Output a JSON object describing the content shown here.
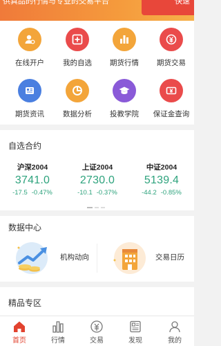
{
  "banner": {
    "text": "供真品的行情与专业的交易平台",
    "right_text": "快速"
  },
  "grid": [
    {
      "label": "在线开户",
      "icon": "user-plus-icon",
      "color": "#f3a53a"
    },
    {
      "label": "我的自选",
      "icon": "plus-square-icon",
      "color": "#ea4b4b"
    },
    {
      "label": "期货行情",
      "icon": "bar-chart-icon",
      "color": "#f3a53a"
    },
    {
      "label": "期货交易",
      "icon": "yuan-coin-icon",
      "color": "#ea4b4b"
    },
    {
      "label": "期货资讯",
      "icon": "news-card-icon",
      "color": "#4a7fe0"
    },
    {
      "label": "数据分析",
      "icon": "pie-chart-icon",
      "color": "#f3a53a"
    },
    {
      "label": "投教学院",
      "icon": "graduation-cap-icon",
      "color": "#8a5ad8"
    },
    {
      "label": "保证金查询",
      "icon": "yuan-ticket-icon",
      "color": "#ea4b4b"
    }
  ],
  "watchlist": {
    "title": "自选合约",
    "quotes": [
      {
        "name": "沪深2004",
        "price": "3741.0",
        "change": "-17.5",
        "pct": "-0.47%"
      },
      {
        "name": "上证2004",
        "price": "2730.0",
        "change": "-10.1",
        "pct": "-0.37%"
      },
      {
        "name": "中证2004",
        "price": "5139.4",
        "change": "-44.2",
        "pct": "-0.85%"
      }
    ],
    "color_down": "#2ea37d"
  },
  "data_center": {
    "title": "数据中心",
    "items": [
      {
        "label": "机构动向",
        "icon": "trend-up-coins-icon"
      },
      {
        "label": "交易日历",
        "icon": "calendar-building-icon"
      }
    ]
  },
  "premium": {
    "title": "精品专区"
  },
  "tabbar": [
    {
      "label": "首页",
      "icon": "home-icon",
      "active": true
    },
    {
      "label": "行情",
      "icon": "bar-chart-icon",
      "active": false
    },
    {
      "label": "交易",
      "icon": "yuan-circle-icon",
      "active": false
    },
    {
      "label": "发现",
      "icon": "discover-icon",
      "active": false
    },
    {
      "label": "我的",
      "icon": "user-icon",
      "active": false
    }
  ],
  "colors": {
    "accent": "#e2432f",
    "orange": "#f3a53a",
    "red": "#ea4b4b",
    "blue": "#4a7fe0",
    "purple": "#8a5ad8"
  }
}
